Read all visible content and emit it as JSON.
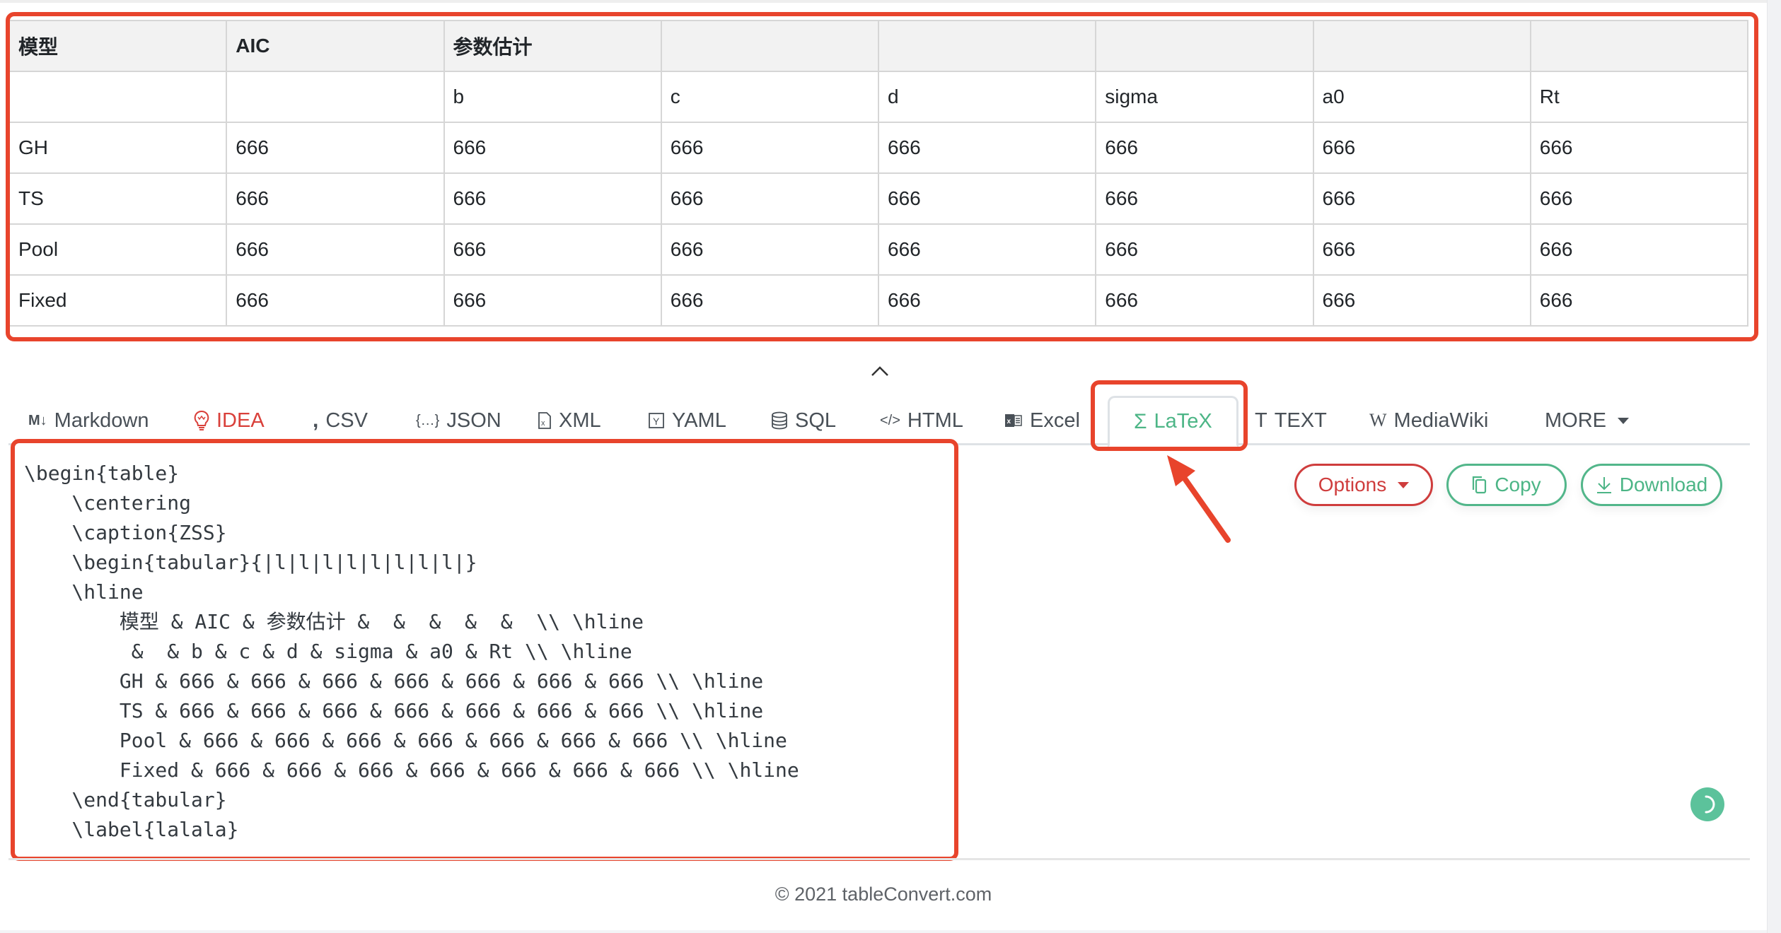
{
  "table": {
    "header_row": [
      "模型",
      "AIC",
      "参数估计",
      "",
      "",
      "",
      "",
      ""
    ],
    "rows": [
      [
        "",
        "",
        "b",
        "c",
        "d",
        "sigma",
        "a0",
        "Rt"
      ],
      [
        "GH",
        "666",
        "666",
        "666",
        "666",
        "666",
        "666",
        "666"
      ],
      [
        "TS",
        "666",
        "666",
        "666",
        "666",
        "666",
        "666",
        "666"
      ],
      [
        "Pool",
        "666",
        "666",
        "666",
        "666",
        "666",
        "666",
        "666"
      ],
      [
        "Fixed",
        "666",
        "666",
        "666",
        "666",
        "666",
        "666",
        "666"
      ]
    ]
  },
  "tabs": [
    {
      "label": "Markdown",
      "icon": "M↓"
    },
    {
      "label": "IDEA",
      "icon": "lightbulb"
    },
    {
      "label": "CSV",
      "icon": "comma"
    },
    {
      "label": "JSON",
      "icon": "{...}"
    },
    {
      "label": "XML",
      "icon": "file-x"
    },
    {
      "label": "YAML",
      "icon": "Y-box"
    },
    {
      "label": "SQL",
      "icon": "database"
    },
    {
      "label": "HTML",
      "icon": "</>"
    },
    {
      "label": "Excel",
      "icon": "excel"
    },
    {
      "label": "LaTeX",
      "icon": "Σ"
    },
    {
      "label": "TEXT",
      "icon": "T"
    },
    {
      "label": "MediaWiki",
      "icon": "W"
    },
    {
      "label": "MORE",
      "icon": "caret-down"
    }
  ],
  "active_tab": "LaTeX",
  "code_lines": [
    "\\begin{table}",
    "    \\centering",
    "    \\caption{ZSS}",
    "    \\begin{tabular}{|l|l|l|l|l|l|l|l|}",
    "    \\hline",
    "        模型 & AIC & 参数估计 &  &  &  &  &  \\\\ \\hline",
    "         &  & b & c & d & sigma & a0 & Rt \\\\ \\hline",
    "        GH & 666 & 666 & 666 & 666 & 666 & 666 & 666 \\\\ \\hline",
    "        TS & 666 & 666 & 666 & 666 & 666 & 666 & 666 \\\\ \\hline",
    "        Pool & 666 & 666 & 666 & 666 & 666 & 666 & 666 \\\\ \\hline",
    "        Fixed & 666 & 666 & 666 & 666 & 666 & 666 & 666 \\\\ \\hline",
    "    \\end{tabular}",
    "    \\label{lalala}"
  ],
  "buttons": {
    "options": "Options",
    "copy": "Copy",
    "download": "Download"
  },
  "footer": "© 2021 tableConvert.com",
  "colors": {
    "annotation": "#e8442c",
    "accent_green": "#4cb586",
    "accent_red": "#cf3d3d"
  }
}
